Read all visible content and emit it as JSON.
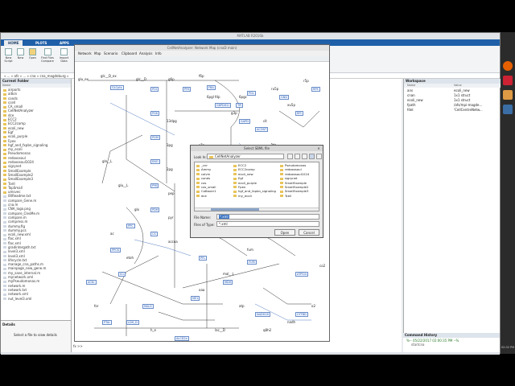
{
  "matlab": {
    "title": "MATLAB R2016b",
    "tabs": [
      "HOME",
      "PLOTS",
      "APPS"
    ],
    "ribbon_buttons": [
      "New Script",
      "New",
      "Open",
      "Find Files",
      "Compare",
      "Import Data"
    ],
    "path": "« ... » afs » ... » cna » cna_magdeburg »",
    "current_folder_title": "Current Folder",
    "current_folder_columns": "Name",
    "folders": [
      "airports",
      "aitkin",
      "conds",
      "ccell",
      "CA_small",
      "CellNetAnalyzer",
      "dce",
      "ECC2",
      "ECC2comp",
      "ecoli_new",
      "Egf",
      "ecoli_purple",
      "Fpex",
      "hgf_and_fxpbn_signaling",
      "my_ecoli",
      "Pseudomonas",
      "redoxosoul",
      "redoxosoul1024",
      "sigrynet",
      "SmallExample",
      "SmallExample2",
      "SmallExample3",
      "Tcell",
      "TopSmall",
      "umsvec"
    ],
    "files": [
      "00Readme.txt",
      "compare_Gene.m",
      "cna.m",
      "CNA_logo.png",
      "compare_ClesMe.m",
      "compare.m",
      "compress.m",
      "dummy.fig",
      "dummy.pcs",
      "ecoli_new.xml",
      "flac.xml",
      "flac.xml",
      "gradintergath.txt",
      "level3.xml",
      "level3.xml",
      "lifecycle.txt",
      "manage_cna_paths.m",
      "mainpage_new_gene.m",
      "my_save_internal.m",
      "mynetwork.xml",
      "myPseudomonas.m",
      "network.m",
      "network.txt",
      "network.xml",
      "nut_level3.xml"
    ],
    "details_label": "Details",
    "details_text": "Select a file to view details",
    "cmd_text": "<fc>Path:",
    "cmd_prompt": "fx >>",
    "workspace_title": "Workspace",
    "workspace_columns": [
      "Name",
      "Value"
    ],
    "workspace_rows": [
      {
        "name": "ans",
        "value": "ecoli_new"
      },
      {
        "name": "cnan",
        "value": "1x1 struct"
      },
      {
        "name": "ecoli_new",
        "value": "1x1 struct"
      },
      {
        "name": "fpath",
        "value": "/afs/mpi-magde..."
      },
      {
        "name": "fdel",
        "value": "'CellCentreNetw..."
      }
    ],
    "history_title": "Command History",
    "history_lines": [
      "%-- 05/22/2017 02:00:35 PM --%",
      "startcna"
    ]
  },
  "cna": {
    "title": "CellNetAnalyzer: Network Map (cnaD main)",
    "menus": [
      "Network",
      "Map",
      "Scenario",
      "Clipboard",
      "Analysis",
      "Info"
    ],
    "nodes": [
      "glu_ex",
      "glc__D_ex",
      "glc__D",
      "g6p",
      "f6p",
      "fdp",
      "g3p",
      "13dpg",
      "3pg",
      "2pg",
      "pep",
      "pyr",
      "accoa",
      "cit",
      "icit",
      "akg",
      "succoa",
      "succ",
      "fum",
      "mal__L",
      "oaa",
      "glx",
      "ac",
      "etoh",
      "lac__D",
      "for",
      "co2",
      "o2",
      "nadh",
      "atp",
      "q8h2",
      "h_e",
      "glu__L",
      "gln__L",
      "6pgl",
      "6pgc",
      "ru5p",
      "xu5p",
      "r5p",
      "s7p",
      "e4p"
    ],
    "boxes": [
      "GLCpts",
      "PGI",
      "PFK",
      "FBA",
      "TPI",
      "GAPD",
      "PGK",
      "PGM",
      "ENO",
      "PYK",
      "PDH",
      "CS",
      "ACONT",
      "ICDHyr",
      "AKGDH",
      "SUCOAS",
      "SDH",
      "FUM",
      "MDH",
      "ME1",
      "PPC",
      "PPCK",
      "ICL",
      "MALS",
      "G6PDH2r",
      "PGL",
      "GND",
      "RPI",
      "RPE",
      "TKT1",
      "TAL",
      "TKT2",
      "ATPS4r",
      "CYTBD",
      "NADH16",
      "ACKr",
      "PTAr",
      "ALCD2x",
      "LDH_D",
      "PFL"
    ]
  },
  "dialog": {
    "title": "Select SBML file",
    "look_in_label": "Look In:",
    "look_in_value": "CellNetAnalyzer",
    "col1": [
      "_cnr",
      "Ammy",
      "calvin",
      "conds",
      "cos",
      "cos_small",
      "CoBauer1",
      "dce"
    ],
    "col2": [
      "ECC2",
      "ECC2comp",
      "ecoli_new",
      "Egf",
      "ecoli_purple",
      "Fpex",
      "hgf_and_fxpbn_signaling",
      "my_ecoli"
    ],
    "col3": [
      "Pseudomonas",
      "redoxosoul",
      "redoxosoul1024",
      "sigrynet",
      "SmallExample",
      "SmallExample2",
      "SmallExample3",
      "Tcell"
    ],
    "file_name_label": "File Name:",
    "file_name_value": "*.xml",
    "file_type_label": "Files of Type:",
    "file_type_value": "*.xml",
    "open_label": "Open",
    "cancel_label": "Cancel"
  },
  "clock": "02:02 PM"
}
